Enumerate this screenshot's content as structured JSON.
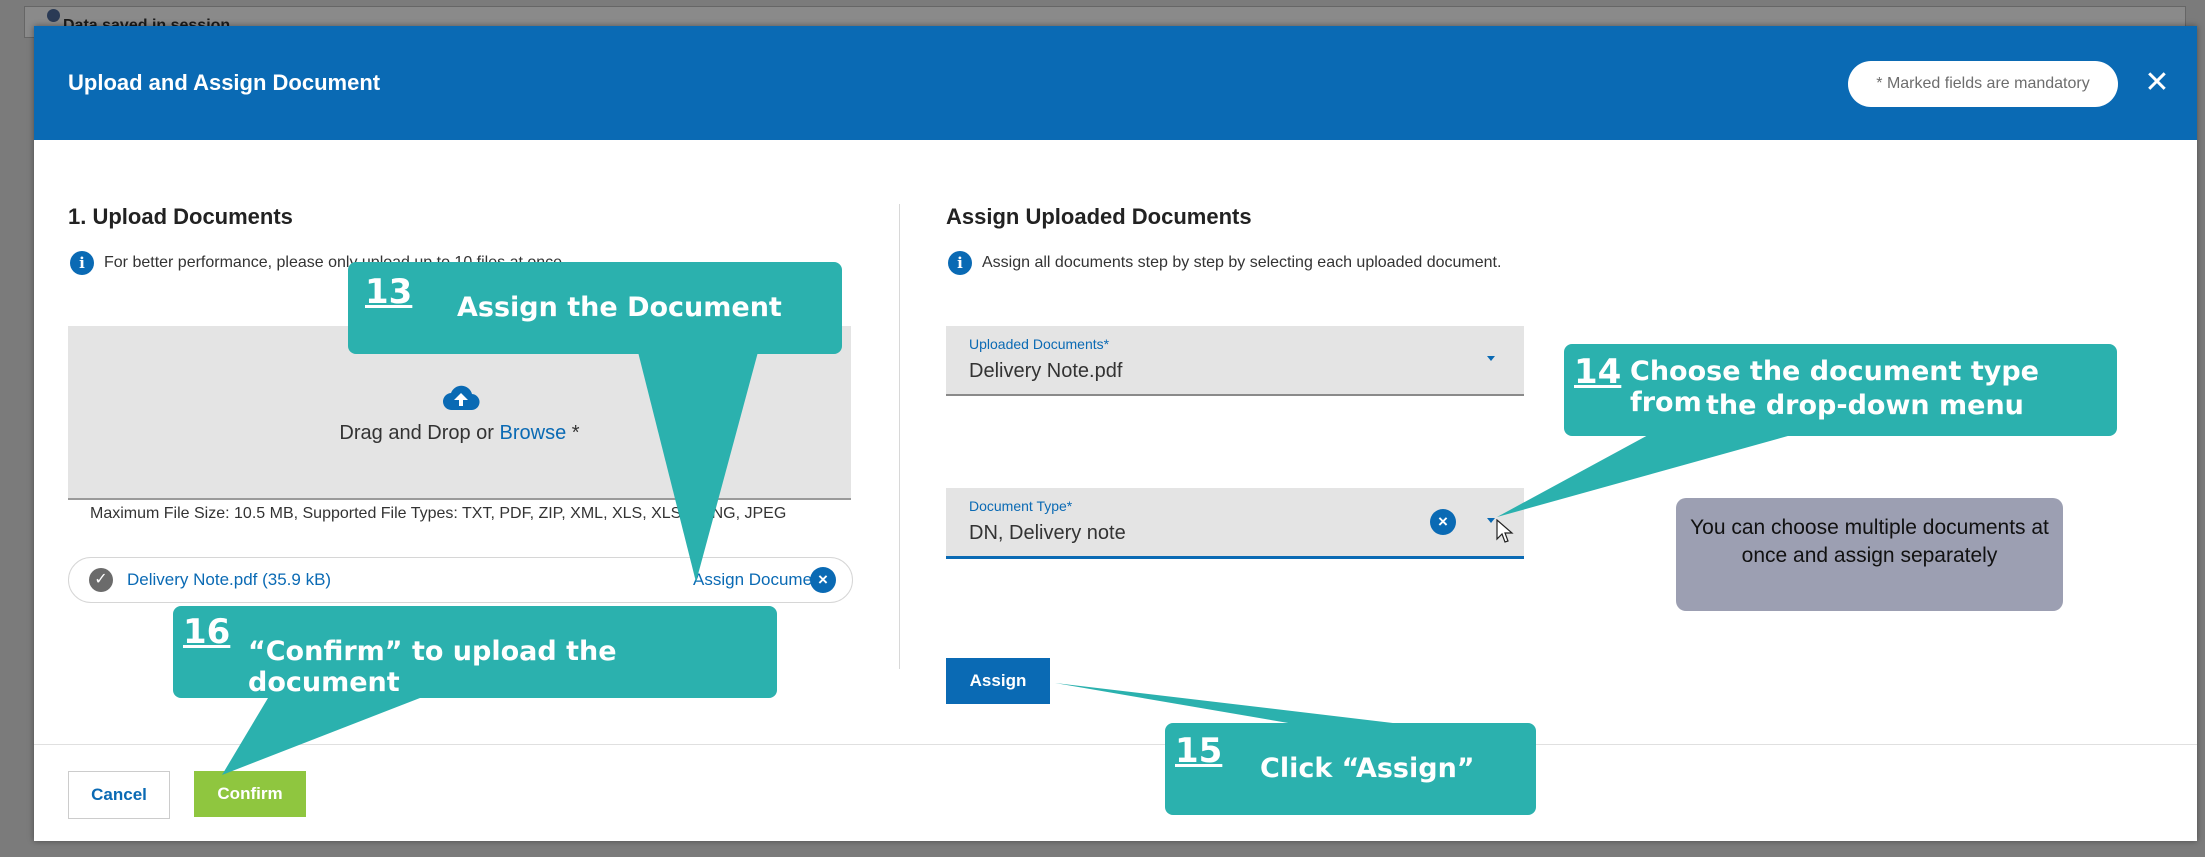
{
  "background": {
    "status_text": "Data saved in session"
  },
  "modal": {
    "title": "Upload and Assign Document",
    "mandatory_note": "* Marked fields are mandatory",
    "close_icon": "close-icon"
  },
  "upload": {
    "title": "1. Upload Documents",
    "info": "For better performance, please only upload up to 10 files at once.",
    "drop_text": "Drag and Drop or",
    "browse": "Browse",
    "required_mark": "*",
    "limits": "Maximum File Size: 10.5 MB, Supported File Types: TXT, PDF, ZIP, XML, XLS, XLSX, PNG, JPEG",
    "file_name": "Delivery Note.pdf (35.9 kB)",
    "assign_link": "Assign Document"
  },
  "assign": {
    "title": "Assign Uploaded Documents",
    "info": "Assign all documents step by step by selecting each uploaded document.",
    "uploaded_label": "Uploaded Documents",
    "uploaded_value": "Delivery Note.pdf",
    "type_label": "Document Type",
    "type_value": "DN, Delivery note",
    "required_mark": "*",
    "assign_button": "Assign"
  },
  "footer": {
    "cancel": "Cancel",
    "confirm": "Confirm"
  },
  "callouts": {
    "c13_num": "13",
    "c13_text": "Assign the Document",
    "c14_num": "14",
    "c14_line1": "Choose the document type from",
    "c14_line2": "the drop-down menu",
    "c15_num": "15",
    "c15_text": "Click “Assign”",
    "c16_num": "16",
    "c16_text": "“Confirm” to upload the document",
    "note": "You can choose multiple documents at once and assign separately"
  },
  "colors": {
    "header_blue": "#0a6ab4",
    "callout_teal": "#2bb1ae",
    "confirm_green": "#8fc63f",
    "note_grey": "#9c9fb2"
  }
}
